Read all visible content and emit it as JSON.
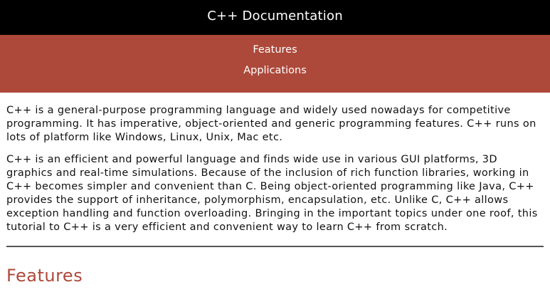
{
  "header": {
    "title": "C++ Documentation"
  },
  "nav": {
    "items": [
      {
        "label": "Features"
      },
      {
        "label": "Applications"
      }
    ]
  },
  "main": {
    "paragraphs": [
      "C++ is a general-purpose programming language and widely used nowadays for competitive programming. It has imperative, object-oriented and generic programming features. C++ runs on lots of platform like Windows, Linux, Unix, Mac etc.",
      "C++ is an efficient and powerful language and finds wide use in various GUI platforms, 3D graphics and real-time simulations. Because of the inclusion of rich function libraries, working in C++ becomes simpler and convenient than C. Being object-oriented programming like Java, C++ provides the support of inheritance, polymorphism, encapsulation, etc. Unlike C, C++ allows exception handling and function overloading. Bringing in the important topics under one roof, this tutorial to C++ is a very efficient and convenient way to learn C++ from scratch."
    ],
    "section_title": "Features"
  },
  "colors": {
    "header_bg": "#000000",
    "nav_bg": "#ad493a",
    "accent": "#ad493a"
  }
}
